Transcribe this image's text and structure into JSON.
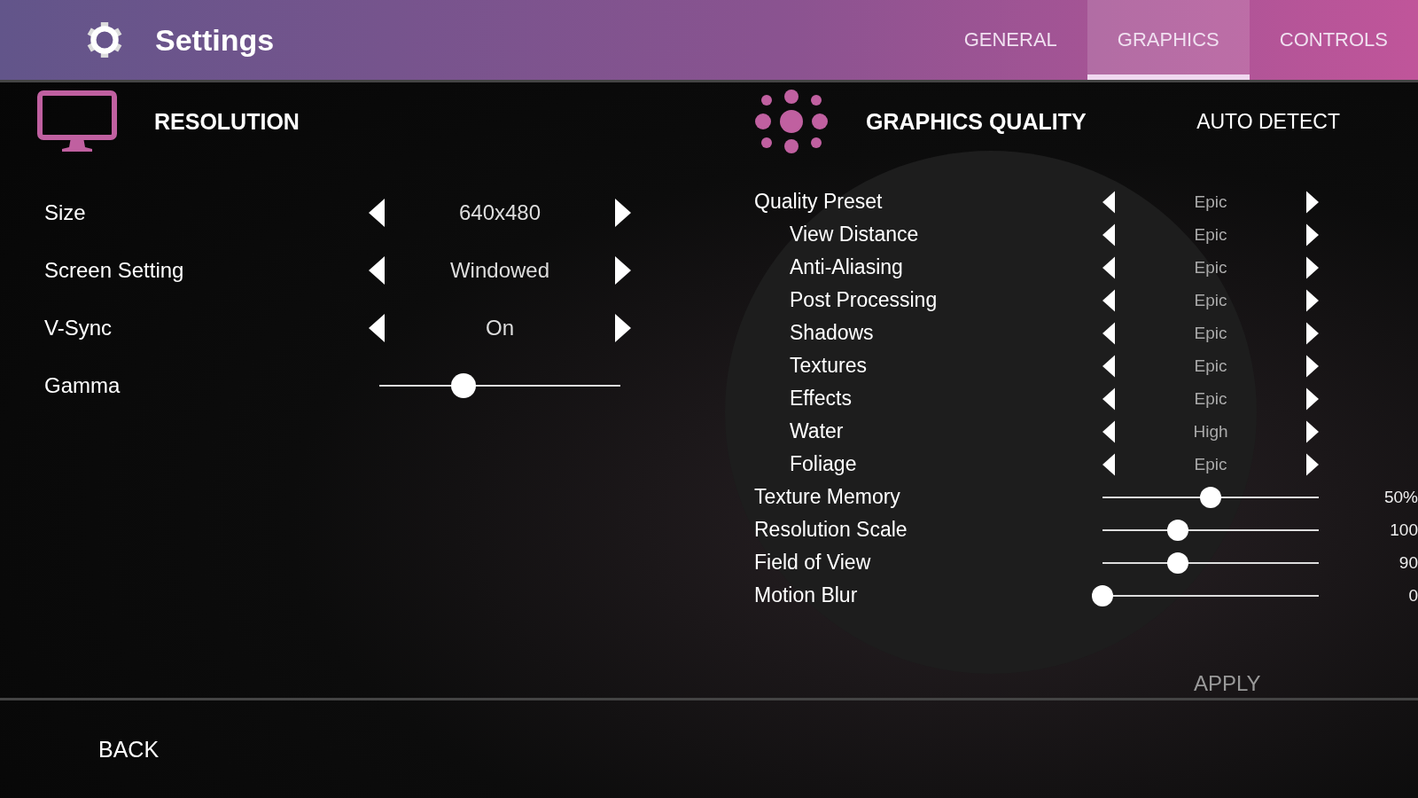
{
  "header": {
    "title": "Settings"
  },
  "tabs": [
    {
      "label": "GENERAL",
      "selected": false
    },
    {
      "label": "GRAPHICS",
      "selected": true
    },
    {
      "label": "CONTROLS",
      "selected": false
    }
  ],
  "resolution": {
    "title": "RESOLUTION",
    "rows": [
      {
        "kind": "selector",
        "label": "Size",
        "value": "640x480"
      },
      {
        "kind": "selector",
        "label": "Screen Setting",
        "value": "Windowed"
      },
      {
        "kind": "selector",
        "label": "V-Sync",
        "value": "On"
      },
      {
        "kind": "slider",
        "label": "Gamma",
        "level": 0.35
      }
    ]
  },
  "graphics": {
    "title": "GRAPHICS QUALITY",
    "auto_detect": "AUTO DETECT",
    "rows": [
      {
        "kind": "selector",
        "label": "Quality Preset",
        "value": "Epic",
        "children": [
          {
            "kind": "selector",
            "label": "View Distance",
            "value": "Epic"
          },
          {
            "kind": "selector",
            "label": "Anti-Aliasing",
            "value": "Epic"
          },
          {
            "kind": "selector",
            "label": "Post Processing",
            "value": "Epic"
          },
          {
            "kind": "selector",
            "label": "Shadows",
            "value": "Epic"
          },
          {
            "kind": "selector",
            "label": "Textures",
            "value": "Epic"
          },
          {
            "kind": "selector",
            "label": "Effects",
            "value": "Epic"
          },
          {
            "kind": "selector",
            "label": "Water",
            "value": "High"
          },
          {
            "kind": "selector",
            "label": "Foliage",
            "value": "Epic"
          }
        ]
      },
      {
        "kind": "slider",
        "label": "Texture Memory",
        "level": 0.5,
        "reading": "50%"
      },
      {
        "kind": "slider",
        "label": "Resolution Scale",
        "level": 0.35,
        "reading": "100"
      },
      {
        "kind": "slider",
        "label": "Field of View",
        "level": 0.35,
        "reading": "90"
      },
      {
        "kind": "slider",
        "label": "Motion Blur",
        "level": 0,
        "reading": "0"
      }
    ],
    "apply": "APPLY"
  },
  "footer": {
    "back": "BACK"
  }
}
